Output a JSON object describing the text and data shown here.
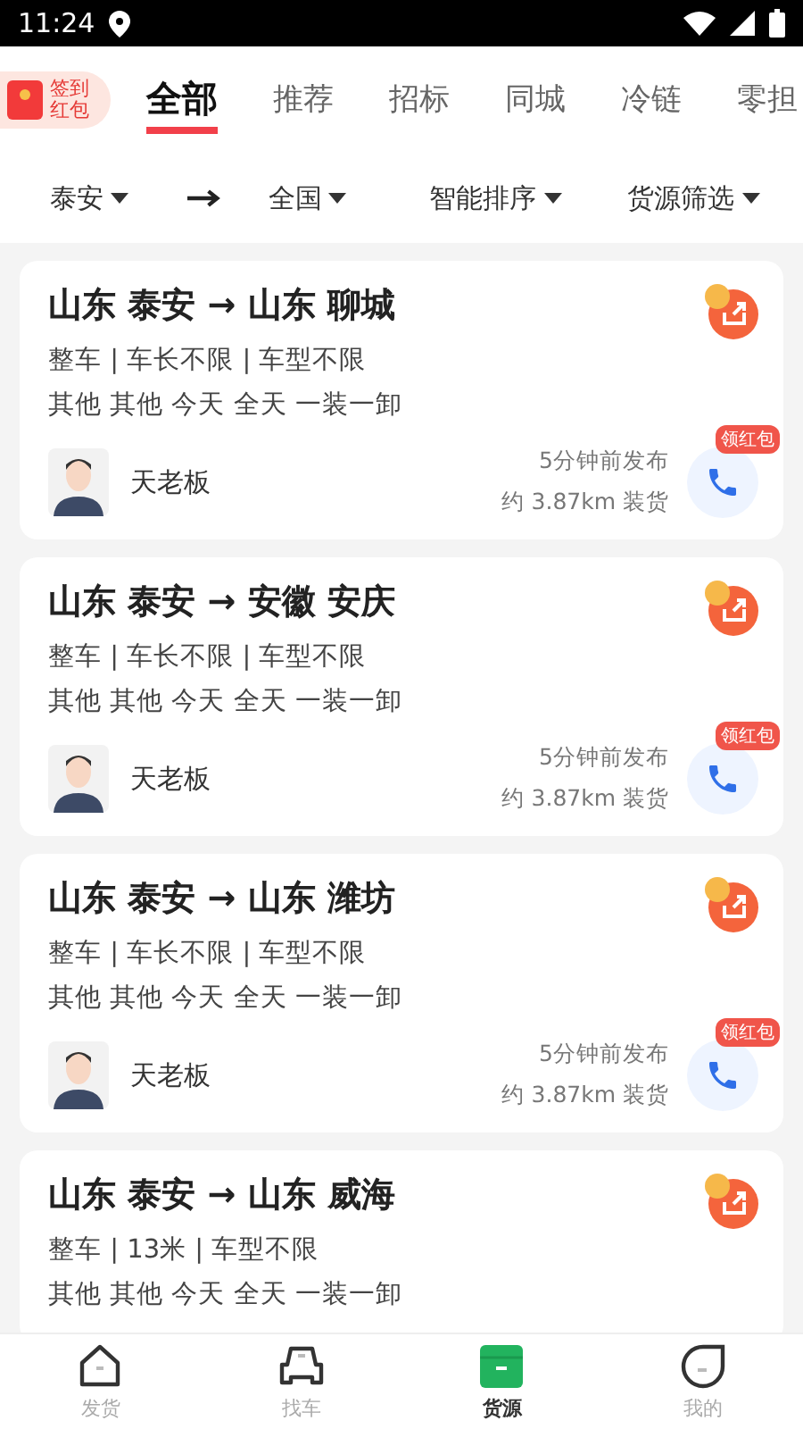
{
  "status_bar": {
    "time": "11:24"
  },
  "sign_in_badge": {
    "line1": "签到",
    "line2": "红包"
  },
  "tabs": [
    {
      "label": "全部",
      "selected": true
    },
    {
      "label": "推荐",
      "selected": false
    },
    {
      "label": "招标",
      "selected": false
    },
    {
      "label": "同城",
      "selected": false
    },
    {
      "label": "冷链",
      "selected": false
    },
    {
      "label": "零担",
      "selected": false
    }
  ],
  "filters": {
    "origin": "泰安",
    "destination": "全国",
    "sort": "智能排序",
    "screen": "货源筛选"
  },
  "listings": [
    {
      "route": "山东 泰安 → 山东 聊城",
      "specs": "整车 | 车长不限 | 车型不限",
      "details": "其他 其他 今天 全天 一装一卸",
      "poster": "天老板",
      "posted": "5分钟前发布",
      "distance": "约 3.87km 装货",
      "bonus_tag": "领红包"
    },
    {
      "route": "山东 泰安 → 安徽 安庆",
      "specs": "整车 | 车长不限 | 车型不限",
      "details": "其他 其他 今天 全天 一装一卸",
      "poster": "天老板",
      "posted": "5分钟前发布",
      "distance": "约 3.87km 装货",
      "bonus_tag": "领红包"
    },
    {
      "route": "山东 泰安 → 山东 潍坊",
      "specs": "整车 | 车长不限 | 车型不限",
      "details": "其他 其他 今天 全天 一装一卸",
      "poster": "天老板",
      "posted": "5分钟前发布",
      "distance": "约 3.87km 装货",
      "bonus_tag": "领红包"
    },
    {
      "route": "山东 泰安 → 山东 威海",
      "specs": "整车 | 13米 | 车型不限",
      "details": "其他 其他 今天 全天 一装一卸"
    }
  ],
  "nav": [
    {
      "label": "发货",
      "kind": "home",
      "selected": false
    },
    {
      "label": "找车",
      "kind": "car",
      "selected": false
    },
    {
      "label": "货源",
      "kind": "box",
      "selected": true
    },
    {
      "label": "我的",
      "kind": "profile",
      "selected": false
    }
  ]
}
